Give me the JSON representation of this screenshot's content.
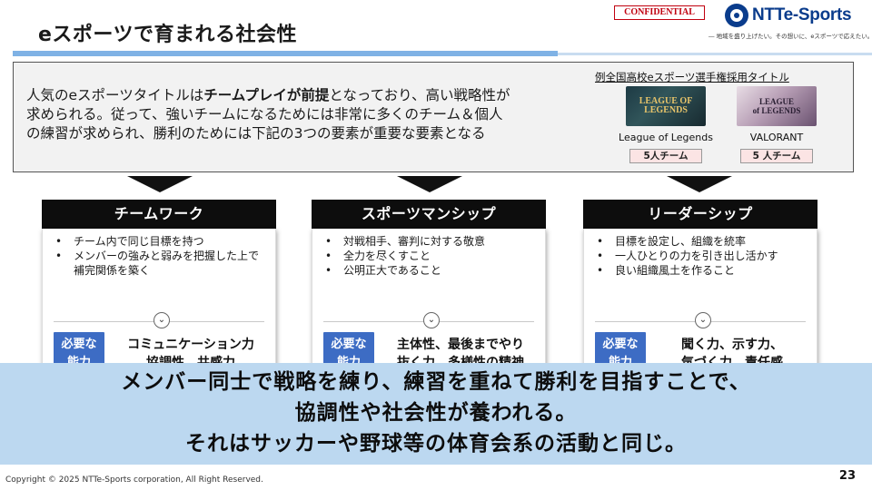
{
  "header": {
    "title": "eスポーツで育まれる社会性",
    "confidential": "CONFIDENTIAL",
    "logo_text": "NTTe-Sports",
    "tagline": "― 地域を盛り上げたい。その想いに、eスポーツで応えたい。 ―"
  },
  "intro": {
    "line1_pre": "人気のeスポーツタイトルは",
    "line1_bold": "チームプレイが前提",
    "line1_post": "となっており、高い戦略性が",
    "line2": "求められる。従って、強いチームになるためには非常に多くのチーム＆個人",
    "line3": "の練習が求められ、勝利のためには下記の3つの要素が重要な要素となる"
  },
  "games": {
    "title": "例全国高校eスポーツ選手権採用タイトル",
    "items": [
      {
        "name": "League of Legends",
        "logo_line1": "LEAGUE OF",
        "logo_line2": "LEGENDS",
        "team": "5人チーム"
      },
      {
        "name": "VALORANT",
        "logo_line1": "LEAGUE",
        "logo_line2": "of LEGENDS",
        "team": "5 人チーム"
      }
    ]
  },
  "columns": [
    {
      "header": "チームワーク",
      "bullets": [
        "チーム内で同じ目標を持つ",
        "メンバーの強みと弱みを把握した上で補完関係を築く"
      ],
      "badge_line1": "必要な",
      "badge_line2": "能力",
      "ability_line1": "コミュニケーション力",
      "ability_line2": "協調性、共感力"
    },
    {
      "header": "スポーツマンシップ",
      "bullets": [
        "対戦相手、審判に対する敬意",
        "全力を尽くすこと",
        "公明正大であること"
      ],
      "badge_line1": "必要な",
      "badge_line2": "能力",
      "ability_line1": "主体性、最後までやり",
      "ability_line2": "抜く力、多様性の精神"
    },
    {
      "header": "リーダーシップ",
      "bullets": [
        "目標を設定し、組織を統率",
        "一人ひとりの力を引き出し活かす",
        "良い組織風土を作ること"
      ],
      "badge_line1": "必要な",
      "badge_line2": "能力",
      "ability_line1": "聞く力、示す力、",
      "ability_line2": "気づく力、責任感"
    }
  ],
  "conclusion": {
    "line1": "メンバー同士で戦略を練り、練習を重ねて勝利を目指すことで、",
    "line2": "協調性や社会性が養われる。",
    "line3": "それはサッカーや野球等の体育会系の活動と同じ。"
  },
  "footer": {
    "copyright": "Copyright © 2025 NTTe-Sports corporation, All Right Reserved.",
    "page_number": "23"
  },
  "colors": {
    "accent_blue": "#3d6cc4",
    "band_blue": "#bcd8f0",
    "confidential_red": "#c0000f",
    "logo_navy": "#0a3c8c"
  },
  "icons": {
    "chevron": "chevron-down-icon",
    "logo": "ntt-esports-logo-icon"
  }
}
